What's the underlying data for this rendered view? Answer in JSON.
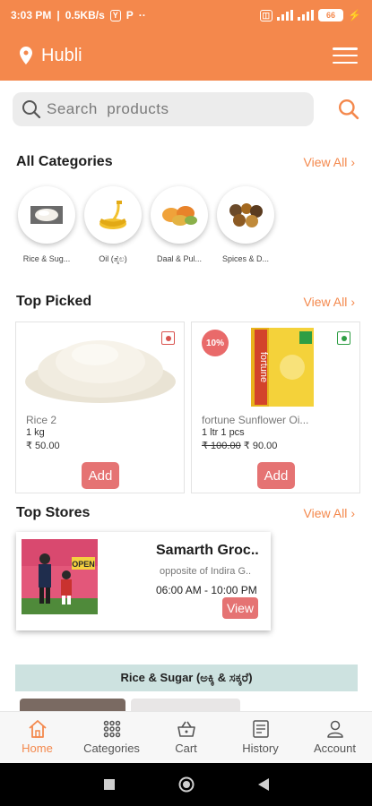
{
  "status": {
    "time": "3:03 PM",
    "speed": "0.5KB/s",
    "battery": "66"
  },
  "header": {
    "location": "Hubli"
  },
  "search": {
    "placeholder": "Search  products"
  },
  "categories_section": {
    "title": "All Categories",
    "view_all": "View All",
    "items": [
      {
        "label": "Rice & Sug..."
      },
      {
        "label": "Oil (ತೈಲ)"
      },
      {
        "label": "Daal & Pul..."
      },
      {
        "label": "Spices & D..."
      }
    ]
  },
  "top_picked": {
    "title": "Top Picked",
    "view_all": "View All",
    "products": [
      {
        "name": "Rice 2",
        "qty": "1 kg",
        "price": "₹ 50.00",
        "old_price": "",
        "discount": "",
        "add": "Add"
      },
      {
        "name": "fortune Sunflower Oi...",
        "qty": "1 ltr 1 pcs",
        "price": "₹ 90.00",
        "old_price": "₹ 100.00",
        "discount": "10%",
        "add": "Add"
      }
    ]
  },
  "top_stores": {
    "title": "Top Stores",
    "view_all": "View All",
    "store": {
      "name": "Samarth Groc..",
      "address": "opposite of Indira G..",
      "hours": "06:00 AM - 10:00 PM",
      "view": "View",
      "image_text": "OPEN"
    }
  },
  "banner": {
    "title": "Rice & Sugar (ಅಕ್ಕಿ & ಸಕ್ಕರೆ)"
  },
  "bottom_nav": {
    "items": [
      {
        "label": "Home"
      },
      {
        "label": "Categories"
      },
      {
        "label": "Cart"
      },
      {
        "label": "History"
      },
      {
        "label": "Account"
      }
    ]
  },
  "colors": {
    "accent": "#f4884c",
    "button": "#e57373",
    "veg_red": "#d9534f",
    "veg_green": "#2e9e44"
  }
}
